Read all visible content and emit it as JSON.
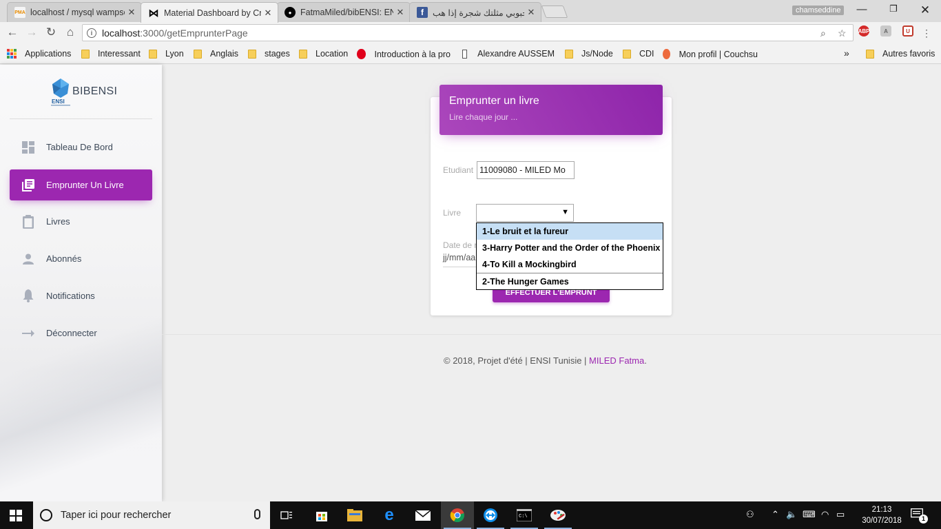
{
  "browser": {
    "tabs": [
      {
        "title": "localhost / mysql wampse",
        "favicon": "phpmyadmin-icon",
        "fav_text": "PMA",
        "active": false
      },
      {
        "title": "Material Dashboard by Cr",
        "favicon": "bowtie-icon",
        "fav_text": "⋈",
        "active": true
      },
      {
        "title": "FatmaMiled/bibENSI: ENS",
        "favicon": "github-icon",
        "fav_text": "●",
        "active": false
      },
      {
        "title": "محبوبي مثلتك شجرة إذا هب",
        "favicon": "facebook-icon",
        "fav_text": "f",
        "active": false
      }
    ],
    "profile_name": "chamseddine",
    "url_host": "localhost",
    "url_path": ":3000/getEmprunterPage",
    "bookmarks": [
      {
        "label": "Applications",
        "icon": "apps-grid-icon"
      },
      {
        "label": "Interessant",
        "icon": "folder-icon"
      },
      {
        "label": "Lyon",
        "icon": "folder-icon"
      },
      {
        "label": "Anglais",
        "icon": "folder-icon"
      },
      {
        "label": "stages",
        "icon": "folder-icon"
      },
      {
        "label": "Location",
        "icon": "folder-icon"
      },
      {
        "label": "Introduction à la pro",
        "icon": "opera-icon"
      },
      {
        "label": "Alexandre AUSSEM ",
        "icon": "page-icon"
      },
      {
        "label": "Js/Node",
        "icon": "folder-icon"
      },
      {
        "label": "CDI",
        "icon": "folder-icon"
      },
      {
        "label": "Mon profil | Couchsu",
        "icon": "couchsurfing-icon"
      }
    ],
    "bookmarks_overflow": "»",
    "other_bookmarks": "Autres favoris"
  },
  "sidebar": {
    "brand": "BIBENSI",
    "logo_text": "ENSI",
    "items": [
      {
        "label": "Tableau De Bord",
        "icon": "dashboard-icon",
        "active": false
      },
      {
        "label": "Emprunter Un Livre",
        "icon": "library-books-icon",
        "active": true
      },
      {
        "label": "Livres",
        "icon": "clipboard-icon",
        "active": false
      },
      {
        "label": "Abonnés",
        "icon": "person-icon",
        "active": false
      },
      {
        "label": "Notifications",
        "icon": "bell-icon",
        "active": false
      },
      {
        "label": "Déconnecter",
        "icon": "arrow-right-icon",
        "active": false
      }
    ]
  },
  "card": {
    "title": "Emprunter un livre",
    "subtitle": "Lire chaque jour ...",
    "etudiant_label": "Etudiant",
    "etudiant_value": "11009080 - MILED Mo",
    "livre_label": "Livre",
    "livre_value": "",
    "date_label": "Date de r",
    "date_placeholder": "jj/mm/aa",
    "submit_label": "EFFECTUER L'EMPRUNT",
    "dropdown_options": [
      {
        "label": "1-Le bruit et la fureur",
        "selected": true
      },
      {
        "label": "3-Harry Potter and the Order of the Phoenix",
        "selected": false
      },
      {
        "label": "4-To Kill a Mockingbird",
        "selected": false
      },
      {
        "label": "2-The Hunger Games",
        "selected": false
      }
    ]
  },
  "footer": {
    "text": "© 2018, Projet d'été | ENSI Tunisie | ",
    "author": "MILED Fatma",
    "end": "."
  },
  "taskbar": {
    "search_placeholder": "Taper ici pour rechercher",
    "time": "21:13",
    "date": "30/07/2018",
    "notification_count": "1"
  },
  "colors": {
    "accent": "#9c27b0",
    "accent_light": "#ab47bc",
    "dropdown_highlight": "#c6dff5"
  }
}
